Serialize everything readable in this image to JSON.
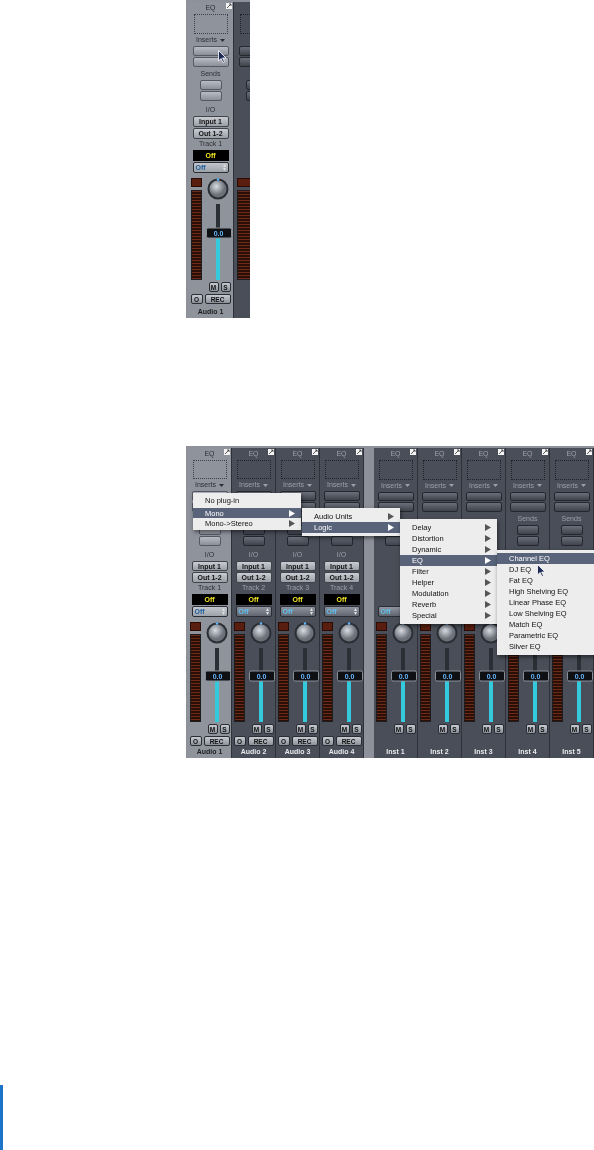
{
  "figures": [
    {
      "groups": [
        {
          "strips": [
            {
              "kind": "audio",
              "selected": true,
              "eq": "EQ",
              "inserts": "Inserts",
              "sends": "Sends",
              "io": "I/O",
              "input": "Input 1",
              "output": "Out 1-2",
              "track": "Track 1",
              "status": "Off",
              "mode": "Off",
              "value": "0.0",
              "level": 0.62,
              "mute": "M",
              "solo": "S",
              "o": "O",
              "rec": "REC",
              "name": "Audio 1"
            },
            {
              "kind": "audio",
              "selected": false
            }
          ]
        }
      ]
    },
    {
      "groups": [
        {
          "strips": [
            {
              "kind": "audio",
              "selected": true,
              "eq": "EQ",
              "inserts": "Inserts",
              "io": "I/O",
              "input": "Input 1",
              "output": "Out 1-2",
              "track": "Track 1",
              "status": "Off",
              "mode": "Off",
              "value": "0.0",
              "level": 0.62,
              "mute": "M",
              "solo": "S",
              "o": "O",
              "rec": "REC",
              "name": "Audio 1"
            },
            {
              "kind": "audio",
              "selected": false,
              "eq": "EQ",
              "inserts": "Inserts",
              "io": "I/O",
              "input": "Input 1",
              "output": "Out 1-2",
              "track": "Track 2",
              "status": "Off",
              "mode": "Off",
              "value": "0.0",
              "level": 0.62,
              "mute": "M",
              "solo": "S",
              "o": "O",
              "rec": "REC",
              "name": "Audio 2"
            },
            {
              "kind": "audio",
              "selected": false,
              "eq": "EQ",
              "inserts": "Inserts",
              "io": "I/O",
              "input": "Input 1",
              "output": "Out 1-2",
              "track": "Track 3",
              "status": "Off",
              "mode": "Off",
              "value": "0.0",
              "level": 0.62,
              "mute": "M",
              "solo": "S",
              "o": "O",
              "rec": "REC",
              "name": "Audio 3"
            },
            {
              "kind": "audio",
              "selected": false,
              "eq": "EQ",
              "inserts": "Inserts",
              "io": "I/O",
              "input": "Input 1",
              "output": "Out 1-2",
              "track": "Track 4",
              "status": "Off",
              "mode": "Off",
              "value": "0.0",
              "level": 0.62,
              "mute": "M",
              "solo": "S",
              "o": "O",
              "rec": "REC",
              "name": "Audio 4"
            }
          ]
        },
        {
          "strips": [
            {
              "kind": "inst",
              "selected": false,
              "eq": "EQ",
              "inserts": "Inserts",
              "mode": "Off",
              "value": "0.0",
              "level": 0.62,
              "mute": "M",
              "solo": "S",
              "name": "Inst 1"
            },
            {
              "kind": "inst",
              "selected": false,
              "eq": "EQ",
              "inserts": "Inserts",
              "value": "0.0",
              "level": 0.62,
              "mute": "M",
              "solo": "S",
              "name": "Inst 2"
            },
            {
              "kind": "inst",
              "selected": false,
              "eq": "EQ",
              "inserts": "Inserts",
              "value": "0.0",
              "level": 0.62,
              "mute": "M",
              "solo": "S",
              "name": "Inst 3"
            },
            {
              "kind": "inst",
              "selected": false,
              "eq": "EQ",
              "inserts": "Inserts",
              "sends": "Sends",
              "value": "0.0",
              "level": 0.62,
              "mute": "M",
              "solo": "S",
              "name": "Inst 4"
            },
            {
              "kind": "inst",
              "selected": false,
              "eq": "EQ",
              "inserts": "Inserts",
              "sends": "Sends",
              "value": "0.0",
              "level": 0.62,
              "mute": "M",
              "solo": "S",
              "name": "Inst 5"
            }
          ]
        }
      ],
      "menus": [
        {
          "items": [
            {
              "label": "No plug-in",
              "selected": false,
              "submenu": false,
              "separator_after": true
            },
            {
              "label": "Mono",
              "selected": true,
              "submenu": true
            },
            {
              "label": "Mono->Stereo",
              "selected": false,
              "submenu": true
            }
          ]
        },
        {
          "items": [
            {
              "label": "Audio Units",
              "selected": false,
              "submenu": true
            },
            {
              "label": "Logic",
              "selected": true,
              "submenu": true
            }
          ]
        },
        {
          "items": [
            {
              "label": "Delay",
              "selected": false,
              "submenu": true
            },
            {
              "label": "Distortion",
              "selected": false,
              "submenu": true
            },
            {
              "label": "Dynamic",
              "selected": false,
              "submenu": true
            },
            {
              "label": "EQ",
              "selected": true,
              "submenu": true
            },
            {
              "label": "Filter",
              "selected": false,
              "submenu": true
            },
            {
              "label": "Helper",
              "selected": false,
              "submenu": true
            },
            {
              "label": "Modulation",
              "selected": false,
              "submenu": true
            },
            {
              "label": "Reverb",
              "selected": false,
              "submenu": true
            },
            {
              "label": "Special",
              "selected": false,
              "submenu": true
            }
          ]
        },
        {
          "items": [
            {
              "label": "Channel EQ",
              "selected": true,
              "submenu": false
            },
            {
              "label": "DJ EQ",
              "selected": false,
              "submenu": false
            },
            {
              "label": "Fat EQ",
              "selected": false,
              "submenu": false
            },
            {
              "label": "High Shelving EQ",
              "selected": false,
              "submenu": false
            },
            {
              "label": "Linear Phase EQ",
              "selected": false,
              "submenu": false
            },
            {
              "label": "Low Shelving EQ",
              "selected": false,
              "submenu": false
            },
            {
              "label": "Match EQ",
              "selected": false,
              "submenu": false
            },
            {
              "label": "Parametric EQ",
              "selected": false,
              "submenu": false
            },
            {
              "label": "Silver EQ",
              "selected": false,
              "submenu": false
            }
          ]
        }
      ]
    }
  ]
}
